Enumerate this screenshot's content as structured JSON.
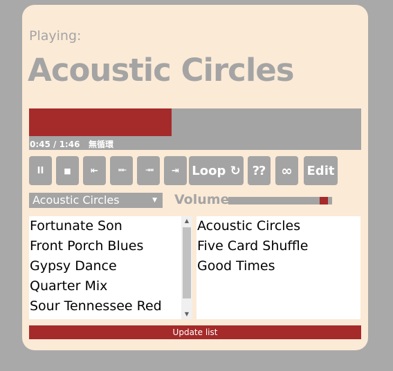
{
  "player": {
    "playing_label": "Playing:",
    "title": "Acoustic Circles",
    "progress_fraction": 0.43,
    "time_text": "0:45 / 1:46",
    "loop_status": "無循環"
  },
  "controls": {
    "pause": "II",
    "stop": "■",
    "prev": "⇤",
    "rewind": "⇤⇤",
    "forward": "⇥⇥",
    "next": "⇥",
    "loop": "Loop ↻",
    "random": "⁇",
    "infinite": "∞",
    "edit": "Edit"
  },
  "playlist_select": {
    "selected": "Acoustic Circles",
    "caret": "▼"
  },
  "volume": {
    "label": "Volume",
    "level": 0.96
  },
  "library": {
    "items": [
      "Fortunate Son",
      "Front Porch Blues",
      "Gypsy Dance",
      "Quarter Mix",
      "Sour Tennessee Red"
    ],
    "scroll_up": "▲",
    "scroll_down": "▼"
  },
  "playlist": {
    "items": [
      "Acoustic Circles",
      "Five Card Shuffle",
      "Good Times"
    ]
  },
  "update_button": "Update list",
  "colors": {
    "background": "#a9a9a9",
    "card": "#fbead6",
    "accent": "#a52a2a",
    "gray": "#a4a4a4"
  }
}
